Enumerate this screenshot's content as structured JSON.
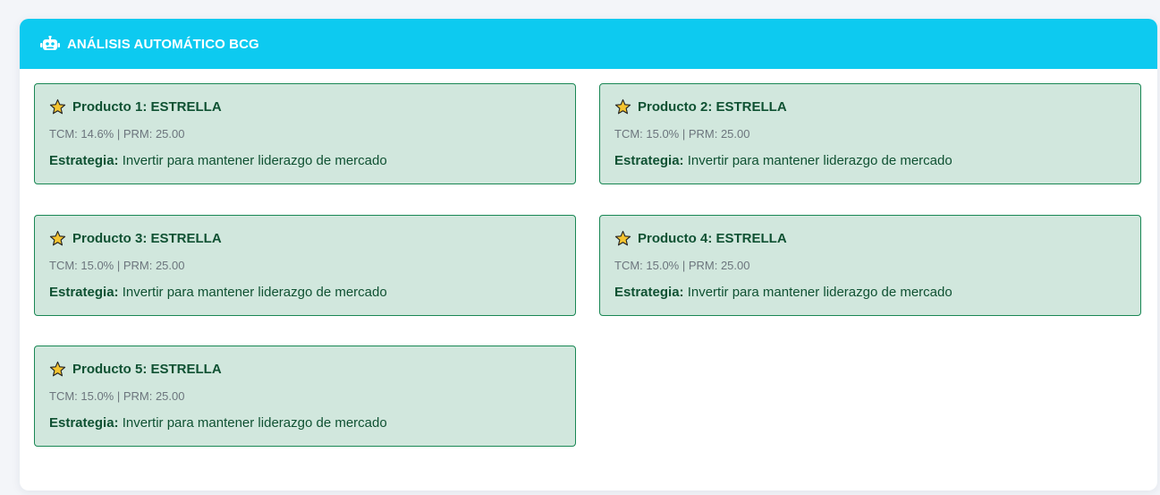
{
  "header": {
    "title": "ANÁLISIS AUTOMÁTICO BCG",
    "icon": "robot-icon",
    "color": "#0dcaf0"
  },
  "colors": {
    "card_bg": "#d1e7dd",
    "card_border": "#198754",
    "text": "#0f5132",
    "muted": "#6c757d",
    "star": "#f4c430"
  },
  "products": [
    {
      "title": "Producto 1: ESTRELLA",
      "metrics": "TCM: 14.6% | PRM: 25.00",
      "strategy_label": "Estrategia:",
      "strategy_text": " Invertir para mantener liderazgo de mercado"
    },
    {
      "title": "Producto 2: ESTRELLA",
      "metrics": "TCM: 15.0% | PRM: 25.00",
      "strategy_label": "Estrategia:",
      "strategy_text": " Invertir para mantener liderazgo de mercado"
    },
    {
      "title": "Producto 3: ESTRELLA",
      "metrics": "TCM: 15.0% | PRM: 25.00",
      "strategy_label": "Estrategia:",
      "strategy_text": " Invertir para mantener liderazgo de mercado"
    },
    {
      "title": "Producto 4: ESTRELLA",
      "metrics": "TCM: 15.0% | PRM: 25.00",
      "strategy_label": "Estrategia:",
      "strategy_text": " Invertir para mantener liderazgo de mercado"
    },
    {
      "title": "Producto 5: ESTRELLA",
      "metrics": "TCM: 15.0% | PRM: 25.00",
      "strategy_label": "Estrategia:",
      "strategy_text": " Invertir para mantener liderazgo de mercado"
    }
  ]
}
